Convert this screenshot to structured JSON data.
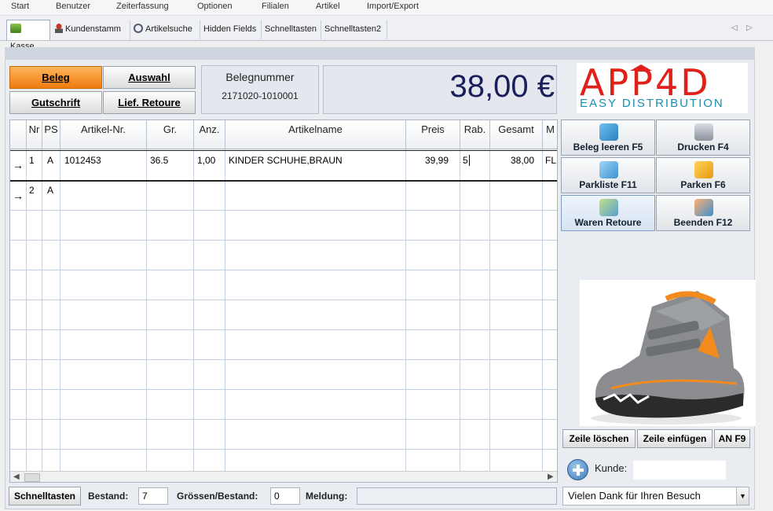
{
  "menu": [
    "Start",
    "Benutzer",
    "Zeiterfassung",
    "Optionen",
    "Filialen",
    "Artikel",
    "Import/Export"
  ],
  "tabs": [
    "Kasse",
    "Kundenstamm",
    "Artikelsuche",
    "Hidden Fields",
    "Schnelltasten",
    "Schnelltasten2"
  ],
  "actions": {
    "beleg": "Beleg",
    "auswahl": "Auswahl",
    "gutschrift": "Gutschrift",
    "lief_retoure": "Lief. Retoure"
  },
  "beleg": {
    "label": "Belegnummer",
    "number": "2171020-1010001"
  },
  "total": "38,00 €",
  "logo": {
    "main": "APP4D",
    "sub": "EASY DISTRIBUTION"
  },
  "table": {
    "columns": [
      "Nr",
      "PS",
      "Artikel-Nr.",
      "Gr.",
      "Anz.",
      "Artikelname",
      "Preis",
      "Rab.",
      "Gesamt",
      "M"
    ],
    "rows": [
      {
        "nr": "1",
        "ps": "A",
        "artikel_nr": "1012453",
        "gr": "36.5",
        "anz": "1,00",
        "artikelname": "KINDER SCHUHE,BRAUN",
        "preis": "39,99",
        "rab": "5",
        "gesamt": "38,00",
        "m": "FL"
      },
      {
        "nr": "2",
        "ps": "A",
        "artikel_nr": "",
        "gr": "",
        "anz": "",
        "artikelname": "",
        "preis": "",
        "rab": "",
        "gesamt": "",
        "m": ""
      }
    ]
  },
  "fkeys": {
    "beleg_leeren": "Beleg leeren F5",
    "drucken": "Drucken F4",
    "parkliste": "Parkliste F11",
    "parken": "Parken F6",
    "waren_retoure": "Waren Retoure",
    "beenden": "Beenden  F12"
  },
  "row_actions": {
    "zeile_loeschen": "Zeile löschen",
    "zeile_einfuegen": "Zeile einfügen",
    "an": "AN F9"
  },
  "kunde": {
    "label": "Kunde:",
    "value": ""
  },
  "message_select": "Vielen Dank für Ihren Besuch",
  "bottom": {
    "schnelltasten": "Schnelltasten",
    "bestand_label": "Bestand:",
    "bestand_value": "7",
    "groessen_label": "Grössen/Bestand:",
    "groessen_value": "0",
    "meldung_label": "Meldung:",
    "meldung_value": ""
  },
  "colors": {
    "accent_orange": "#f07a10",
    "total_text": "#1a1f5c",
    "logo_red": "#e0201a",
    "logo_blue": "#1a8fb0"
  }
}
